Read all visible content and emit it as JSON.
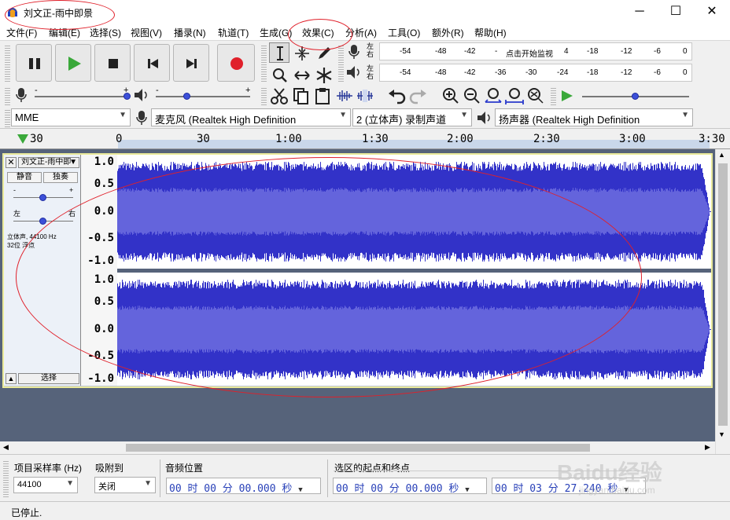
{
  "window": {
    "title": "刘文正-雨中即景",
    "minimize": "─",
    "maximize": "☐",
    "close": "✕"
  },
  "menu": [
    "文件(F)",
    "编辑(E)",
    "选择(S)",
    "视图(V)",
    "播录(N)",
    "轨道(T)",
    "生成(G)",
    "效果(C)",
    "分析(A)",
    "工具(O)",
    "额外(R)",
    "帮助(H)"
  ],
  "meters": {
    "record_labels": [
      "-54",
      "-48",
      "-42",
      "-",
      "点击开始监视",
      "4",
      "-18",
      "-12",
      "-6",
      "0"
    ],
    "play_labels": [
      "-54",
      "-48",
      "-42",
      "-36",
      "-30",
      "-24",
      "-18",
      "-12",
      "-6",
      "0"
    ],
    "left": "左",
    "right": "右"
  },
  "sliders": {
    "record_volume": 1.0,
    "play_volume": 0.33,
    "play_speed": 0.5,
    "minus": "-",
    "plus": "+"
  },
  "devices": {
    "host": "MME",
    "mic": "麦克风 (Realtek High Definition",
    "channels": "2 (立体声) 录制声道",
    "speaker": "扬声器 (Realtek High Definition"
  },
  "ruler": {
    "labels": [
      "30",
      "0",
      "30",
      "1:00",
      "1:30",
      "2:00",
      "2:30",
      "3:00",
      "3:30"
    ]
  },
  "track": {
    "name": "刘文正-雨中即",
    "mute": "静音",
    "solo": "独奏",
    "gain_minus": "-",
    "gain_plus": "+",
    "pan_left": "左",
    "pan_right": "右",
    "info_line1": "立体声, 44100 Hz",
    "info_line2": "32位 浮点",
    "select": "选择",
    "vruler_labels": [
      "1.0",
      "0.5",
      "0.0",
      "-0.5",
      "-1.0"
    ],
    "duration_seconds": 207.24
  },
  "selection_bar": {
    "rate_label": "项目采样率 (Hz)",
    "rate_value": "44100",
    "snap_label": "吸附到",
    "snap_value": "关闭",
    "audio_pos_label": "音频位置",
    "audio_pos_value": "00 时 00 分 00.000 秒",
    "sel_label": "选区的起点和终点",
    "sel_start": "00 时 00 分 00.000 秒",
    "sel_end": "00 时 03 分 27.240 秒"
  },
  "status": {
    "text": "已停止."
  },
  "watermark": {
    "brand": "Baidu经验",
    "url": "jingyan.baidu.com"
  },
  "colors": {
    "wave": "#3232c8",
    "wave_rms": "#6464dc",
    "track_bg": "#56637a",
    "record": "#e0202a",
    "play": "#3aa83a"
  }
}
